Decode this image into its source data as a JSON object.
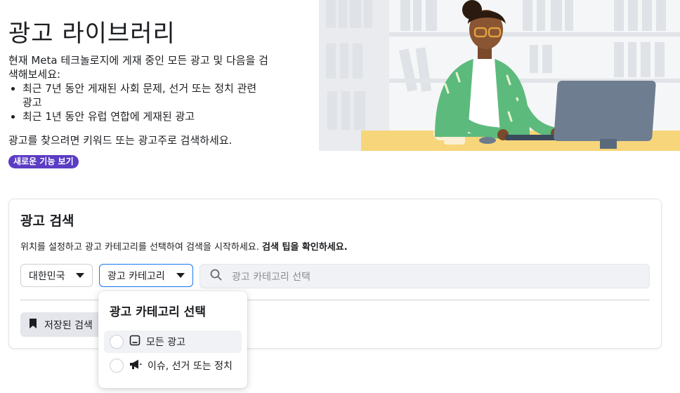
{
  "hero": {
    "title": "광고 라이브러리",
    "intro": "현재 Meta 테크놀로지에 게재 중인 모든 광고 및 다음을 검색해보세요:",
    "bullets": [
      "최근 7년 동안 게재된 사회 문제, 선거 또는 정치 관련 광고",
      "최근 1년 동안 유럽 연합에 게재된 광고"
    ],
    "search_hint": "광고를 찾으려면 키워드 또는 광고주로 검색하세요.",
    "new_features_badge": "새로운 기능 보기"
  },
  "search_panel": {
    "title": "광고 검색",
    "description": "위치를 설정하고 광고 카테고리를 선택하여 검색을 시작하세요.",
    "tips_link": "검색 팁을 확인하세요.",
    "country_select": "대한민국",
    "category_select": "광고 카테고리",
    "search_placeholder": "광고 카테고리 선택",
    "saved_searches_button": "저장된 검색"
  },
  "category_dropdown": {
    "title": "광고 카테고리 선택",
    "options": [
      {
        "label": "모든 광고",
        "icon": "tablet-icon"
      },
      {
        "label": "이슈, 선거 또는 정치",
        "icon": "megaphone-icon"
      }
    ]
  },
  "colors": {
    "badge": "#5b3cc4",
    "focus_border": "#1877f2",
    "input_bg": "#f0f2f5"
  }
}
